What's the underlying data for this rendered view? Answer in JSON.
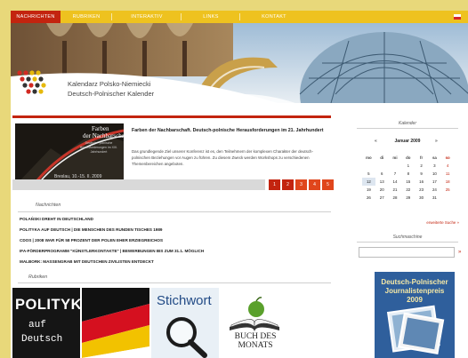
{
  "nav": {
    "items": [
      "NACHRICHTEN",
      "RUBRIKEN",
      "INTERAKTIV",
      "LINKS",
      "KONTAKT"
    ]
  },
  "logo": {
    "line1": "Kalendarz Polsko-Niemiecki",
    "line2": "Deutsch-Polnischer Kalender"
  },
  "feature": {
    "image_title_1": "Farben",
    "image_title_2": "der Nachbarschaft",
    "image_subtitle": "Deutsch - polnische Herausforderungen im XXI. Jahrhundert",
    "image_date": "Breslau, 10.-15. II. 2009",
    "heading": "Farben der Nachbarschaft. Deutsch-polnische Herausforderungen im 21. Jahrhundert",
    "text": "Das grundlegende Ziel unserer Konferenz ist es, den Teilnehmern der komplexen Charakter der deutsch-polnischen Beziehungen vor Augen zu führen. Zu diesem Zweck werden Workshops zu verschiedenen Themenbereichen angeboten.",
    "pages": [
      "1",
      "2",
      "3",
      "4",
      "5"
    ]
  },
  "news": {
    "label": "Nachrichten",
    "items": [
      "POLAŃSKI DREHT IN DEUTSCHLAND",
      "POLITYKA AUF DEUTSCH | DIE MENSCHEN DES RUNDEN TISCHES 1989",
      "CDOS | 2008 WAR FÜR 58 PROZENT DER POLEN EHER ERZIEGREICHOS",
      "IFA-FÖRDERPROGRAMM \"KÜNSTLERKONTAKTE\" | BEWERBUNGEN BIS ZUM 31.1. MÖGLICH",
      "MALBORK: MASSENGRAB MIT DEUTSCHEN ZIVILISTEN ENTDECKT"
    ]
  },
  "rubrics": {
    "label": "Rubriken",
    "polityka_title": "POLITYKA",
    "polityka_line2": "auf",
    "polityka_line3": "Deutsch",
    "stichwort": "Stichwort",
    "buch_line1": "BUCH DES",
    "buch_line2": "MONATS"
  },
  "calendar": {
    "title": "Kalender",
    "month": "Januar 2009",
    "prev": "«",
    "next": "»",
    "weekdays": [
      "mo",
      "di",
      "mi",
      "do",
      "fr",
      "sa",
      "so"
    ],
    "weeks": [
      [
        "",
        "",
        "",
        "1",
        "2",
        "3",
        "4"
      ],
      [
        "5",
        "6",
        "7",
        "8",
        "9",
        "10",
        "11"
      ],
      [
        "12",
        "13",
        "14",
        "15",
        "16",
        "17",
        "18"
      ],
      [
        "19",
        "20",
        "21",
        "22",
        "23",
        "24",
        "25"
      ],
      [
        "26",
        "27",
        "28",
        "29",
        "30",
        "31",
        ""
      ]
    ],
    "more": "erweiterte Suche »"
  },
  "search": {
    "title": "Suchmaschine",
    "value": "",
    "button": "»"
  },
  "promo": {
    "line1": "Deutsch-Polnischer",
    "line2": "Journalistenpreis",
    "line3": "2009"
  },
  "colors": {
    "accent_red": "#c3240f",
    "nav_yellow": "#eec21f",
    "orange_pager": "#e0461c"
  }
}
